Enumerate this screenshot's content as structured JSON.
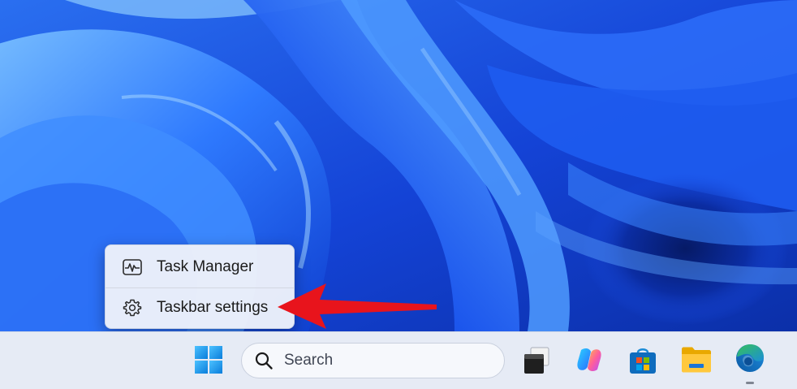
{
  "wallpaper": {
    "name": "windows-11-bloom",
    "colors": [
      "#0a2a8c",
      "#1c57f0",
      "#3a86ff",
      "#7ec0ff"
    ]
  },
  "context_menu": {
    "items": [
      {
        "label": "Task Manager",
        "icon": "task-manager-icon"
      },
      {
        "label": "Taskbar settings",
        "icon": "gear-icon"
      }
    ]
  },
  "annotation": {
    "type": "arrow",
    "color": "#e8141c",
    "points_to": "Taskbar settings"
  },
  "taskbar": {
    "search": {
      "placeholder": "Search",
      "icon": "search-icon"
    },
    "apps": [
      {
        "name": "Start",
        "icon": "windows-logo-icon"
      },
      {
        "name": "Task View",
        "icon": "task-view-icon"
      },
      {
        "name": "Copilot",
        "icon": "copilot-icon"
      },
      {
        "name": "Microsoft Store",
        "icon": "store-icon"
      },
      {
        "name": "File Explorer",
        "icon": "folder-icon"
      },
      {
        "name": "Microsoft Edge",
        "icon": "edge-icon",
        "running": true
      }
    ],
    "background": "#e6ebf5"
  }
}
